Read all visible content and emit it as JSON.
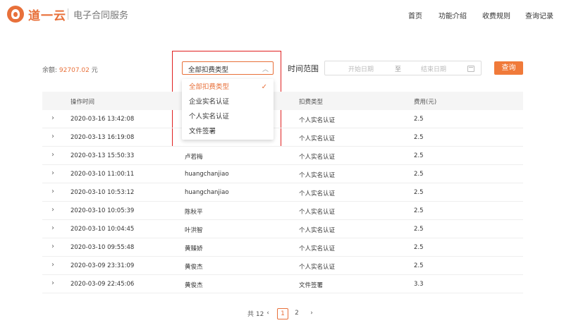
{
  "header": {
    "brand": "道一云",
    "subtitle": "电子合同服务",
    "nav": [
      "首页",
      "功能介绍",
      "收费规则",
      "查询记录"
    ]
  },
  "filters": {
    "balance_label": "余额:",
    "balance_value": "92707.02",
    "balance_unit": "元",
    "select_value": "全部扣费类型",
    "options": [
      "全部扣费类型",
      "企业实名认证",
      "个人实名认证",
      "文件签署"
    ],
    "selected_option": "全部扣费类型",
    "time_label": "时间范围",
    "date_start_placeholder": "开始日期",
    "date_separator": "至",
    "date_end_placeholder": "结束日期",
    "query_label": "查询"
  },
  "table": {
    "headers": [
      "操作时间",
      "",
      "扣费类型",
      "费用(元)"
    ],
    "rows": [
      {
        "time": "2020-03-16 13:42:08",
        "name": "",
        "type": "个人实名认证",
        "fee": "2.5"
      },
      {
        "time": "2020-03-13 16:19:08",
        "name": "",
        "type": "个人实名认证",
        "fee": "2.5"
      },
      {
        "time": "2020-03-13 15:50:33",
        "name": "卢若梅",
        "type": "个人实名认证",
        "fee": "2.5"
      },
      {
        "time": "2020-03-10 11:00:11",
        "name": "huangchanjiao",
        "type": "个人实名认证",
        "fee": "2.5"
      },
      {
        "time": "2020-03-10 10:53:12",
        "name": "huangchanjiao",
        "type": "个人实名认证",
        "fee": "2.5"
      },
      {
        "time": "2020-03-10 10:05:39",
        "name": "陈秋平",
        "type": "个人实名认证",
        "fee": "2.5"
      },
      {
        "time": "2020-03-10 10:04:45",
        "name": "叶洪智",
        "type": "个人实名认证",
        "fee": "2.5"
      },
      {
        "time": "2020-03-10 09:55:48",
        "name": "黄臻娇",
        "type": "个人实名认证",
        "fee": "2.5"
      },
      {
        "time": "2020-03-09 23:31:09",
        "name": "黄俊杰",
        "type": "个人实名认证",
        "fee": "2.5"
      },
      {
        "time": "2020-03-09 22:45:06",
        "name": "黄俊杰",
        "type": "文件签署",
        "fee": "3.3"
      }
    ]
  },
  "pagination": {
    "total_label": "共 12",
    "pages": [
      "1",
      "2"
    ],
    "current": "1"
  },
  "icons": {
    "prev": "chevron-left-icon",
    "next": "chevron-right-icon",
    "expand": "chevron-right-icon",
    "select_arrow": "chevron-up-icon",
    "calendar": "calendar-icon",
    "check": "check-icon"
  },
  "colors": {
    "accent": "#e8703a",
    "highlight_box": "#e02020"
  }
}
